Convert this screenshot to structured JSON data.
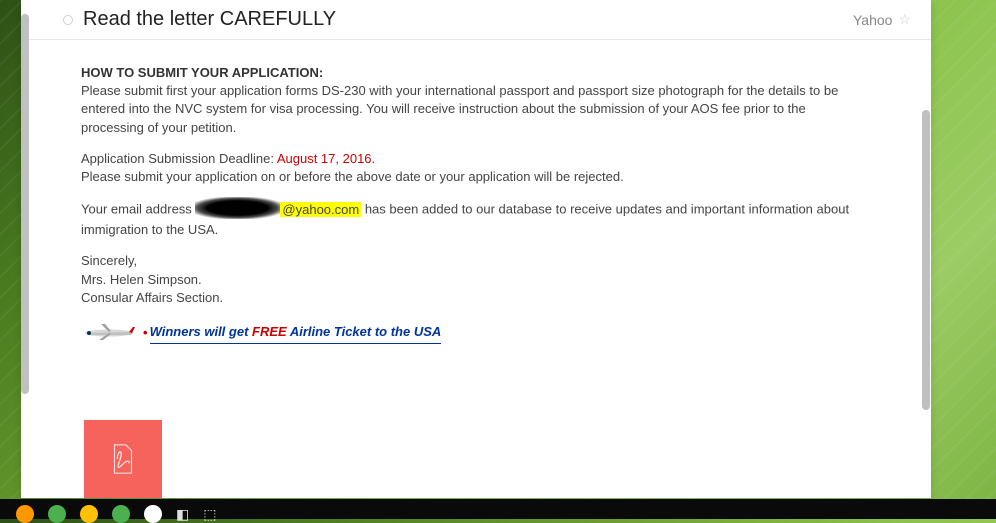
{
  "header": {
    "subject": "Read the letter CAREFULLY",
    "sender": "Yahoo"
  },
  "body": {
    "heading": "HOW TO SUBMIT YOUR APPLICATION:",
    "intro": "Please submit first your application forms DS-230 with your international passport and passport size photograph for the details to be entered into the NVC system for visa processing. You will receive instruction about the submission of your AOS fee prior to the processing of your petition.",
    "deadline_label": "Application Submission Deadline: ",
    "deadline_date": "August 17, 2016.",
    "deadline_note": "Please submit your application on or before the above date or your application will be rejected.",
    "email_line_prefix": "Your email address ",
    "email_domain": "@yahoo.com",
    "email_line_suffix": " has been added to our database to receive updates and important information about immigration to the USA.",
    "sincerely": "Sincerely,",
    "signer_name": "Mrs. Helen Simpson.",
    "signer_title": "Consular Affairs Section.",
    "winners_prefix": "Winners will get ",
    "winners_free": "FREE",
    "winners_suffix": " Airline Ticket to the USA"
  }
}
